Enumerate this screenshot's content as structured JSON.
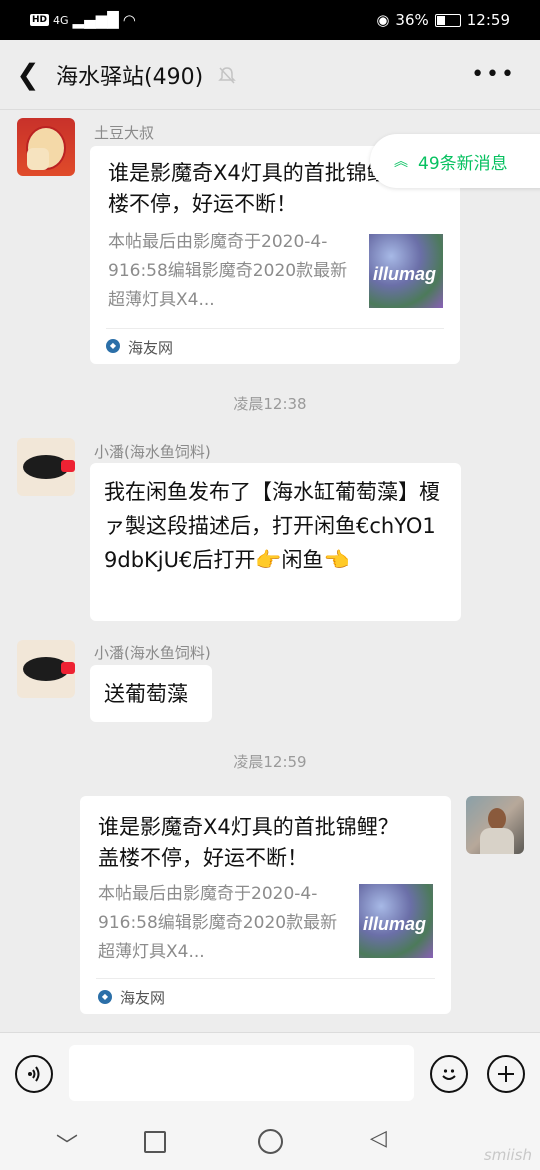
{
  "status_bar": {
    "hd": "HD",
    "signal": "4G",
    "battery_percent": "36%",
    "battery_level": 0.36,
    "time": "12:59"
  },
  "header": {
    "back_icon": "chevron-left-icon",
    "title": "海水驿站(490)",
    "muted_icon": "bell-off-icon",
    "more_icon": "more-horizontal-icon"
  },
  "new_messages": {
    "label": "49条新消息",
    "color": "#07c160"
  },
  "messages": [
    {
      "sender": "土豆大叔",
      "type": "link",
      "title": "谁是影魔奇X4灯具的首批锦鲤？盖楼不停，好运不断！",
      "desc": "本帖最后由影魔奇于2020-4-916:58编辑影魔奇2020款最新超薄灯具X4...",
      "thumb_text": "illumag",
      "source": "海友网"
    },
    {
      "timestamp": "凌晨12:38"
    },
    {
      "sender": "小潘(海水鱼饲料)",
      "type": "text",
      "text": "我在闲鱼发布了【海水缸葡萄藻】榎ァ製这段描述后，打开闲鱼€chYO19dbKjU€后打开👉闲鱼👈"
    },
    {
      "sender": "小潘(海水鱼饲料)",
      "type": "text",
      "text": "送葡萄藻"
    },
    {
      "timestamp": "凌晨12:59"
    },
    {
      "sender": "me",
      "type": "link",
      "title": "谁是影魔奇X4灯具的首批锦鲤？盖楼不停，好运不断！",
      "desc": "本帖最后由影魔奇于2020-4-916:58编辑影魔奇2020款最新超薄灯具X4...",
      "thumb_text": "illumag",
      "source": "海友网"
    }
  ],
  "input_bar": {
    "voice_icon": "voice-icon",
    "emoji_icon": "emoji-icon",
    "plus_icon": "plus-icon",
    "text_value": ""
  },
  "nav_bar": {
    "back_icon": "nav-down-icon",
    "recent_icon": "nav-square-icon",
    "home_icon": "nav-circle-icon",
    "back2_icon": "nav-triangle-icon",
    "watermark": "smiish"
  }
}
